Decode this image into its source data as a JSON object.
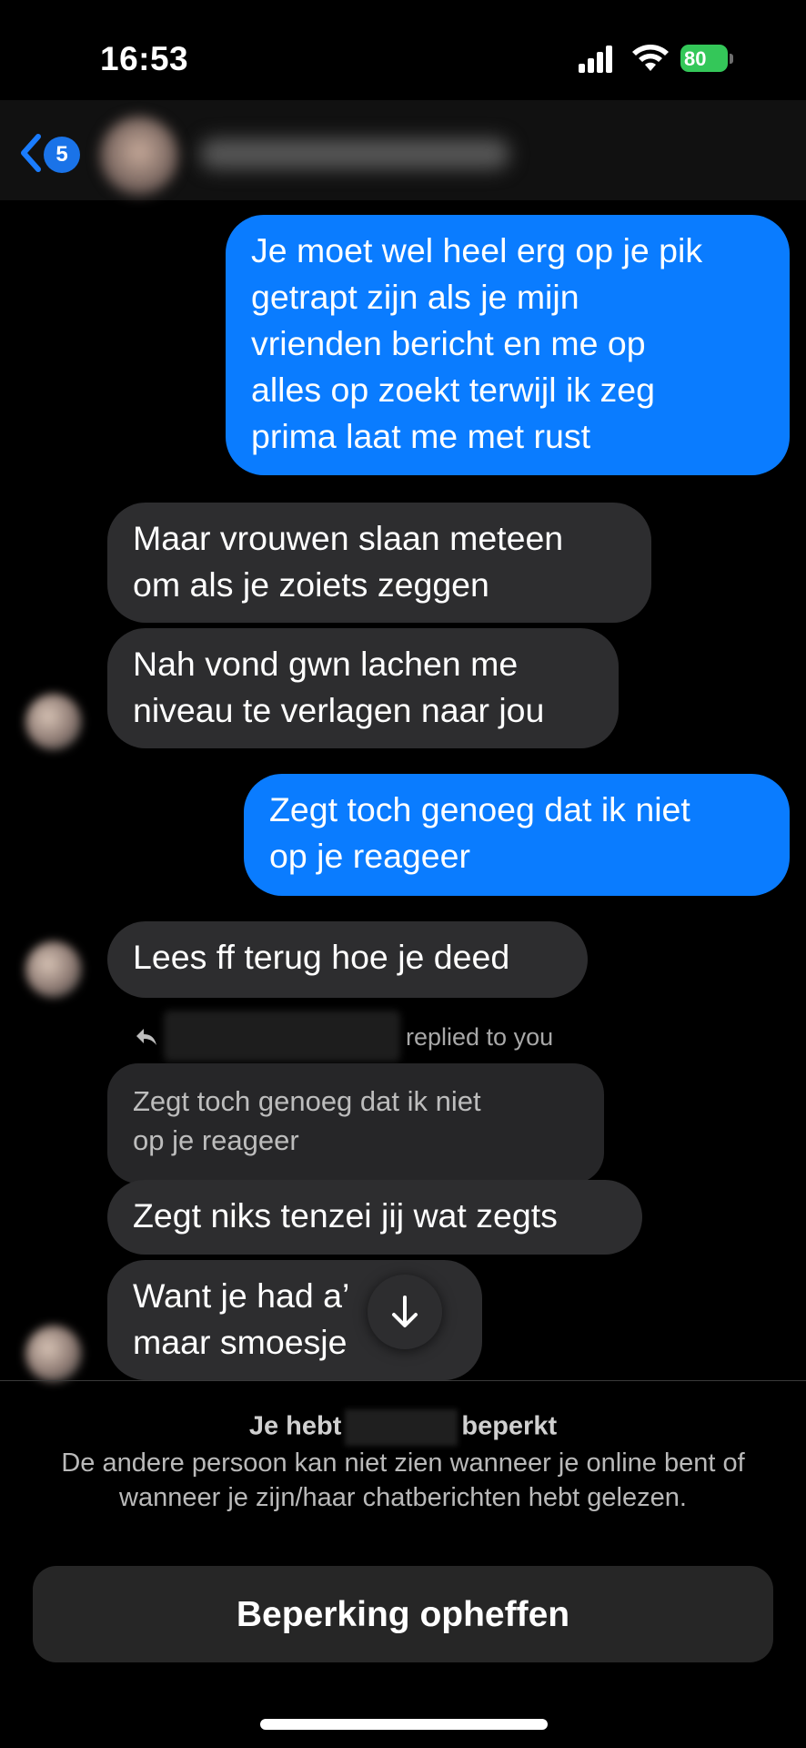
{
  "status_bar": {
    "time": "16:53",
    "battery_percent": "80"
  },
  "header": {
    "back_badge_count": "5",
    "contact_name_blurred": true
  },
  "messages": [
    {
      "direction": "outgoing",
      "lines": [
        "Je moet wel heel erg op je pik",
        "getrapt zijn als je mijn",
        "vrienden bericht en me op",
        "alles op zoekt terwijl ik zeg",
        "prima laat me met rust"
      ]
    },
    {
      "direction": "incoming",
      "lines": [
        "Maar vrouwen slaan meteen",
        "om als je zoiets zeggen"
      ]
    },
    {
      "direction": "incoming",
      "lines": [
        "Nah vond gwn lachen me",
        "niveau te verlagen naar jou"
      ]
    },
    {
      "direction": "outgoing",
      "lines": [
        "Zegt toch genoeg dat ik niet",
        "op je reageer"
      ]
    },
    {
      "direction": "incoming",
      "lines": [
        "Lees ff terug hoe je deed"
      ]
    },
    {
      "direction": "incoming",
      "lines": [
        "Zegt niks tenzei jij wat zegts"
      ]
    },
    {
      "direction": "incoming",
      "lines": [
        "Want je had a’   n",
        "maar smoesje"
      ]
    }
  ],
  "reply": {
    "label": "replied to you",
    "quoted_lines": [
      "Zegt toch genoeg dat ik niet",
      "op je reageer"
    ]
  },
  "restriction": {
    "title_prefix": "Je hebt",
    "title_suffix": "beperkt",
    "description": "De andere persoon kan niet zien wanneer je online bent of wanneer je zijn/haar chatberichten hebt gelezen.",
    "button_label": "Beperking opheffen"
  },
  "colors": {
    "outgoing_bubble": "#0a7cff",
    "incoming_bubble": "#2d2d2f",
    "background": "#000000",
    "battery": "#34c759"
  },
  "icons": [
    "back-chevron-icon",
    "signal-icon",
    "wifi-icon",
    "battery-icon",
    "reply-arrow-icon",
    "arrow-down-icon"
  ]
}
